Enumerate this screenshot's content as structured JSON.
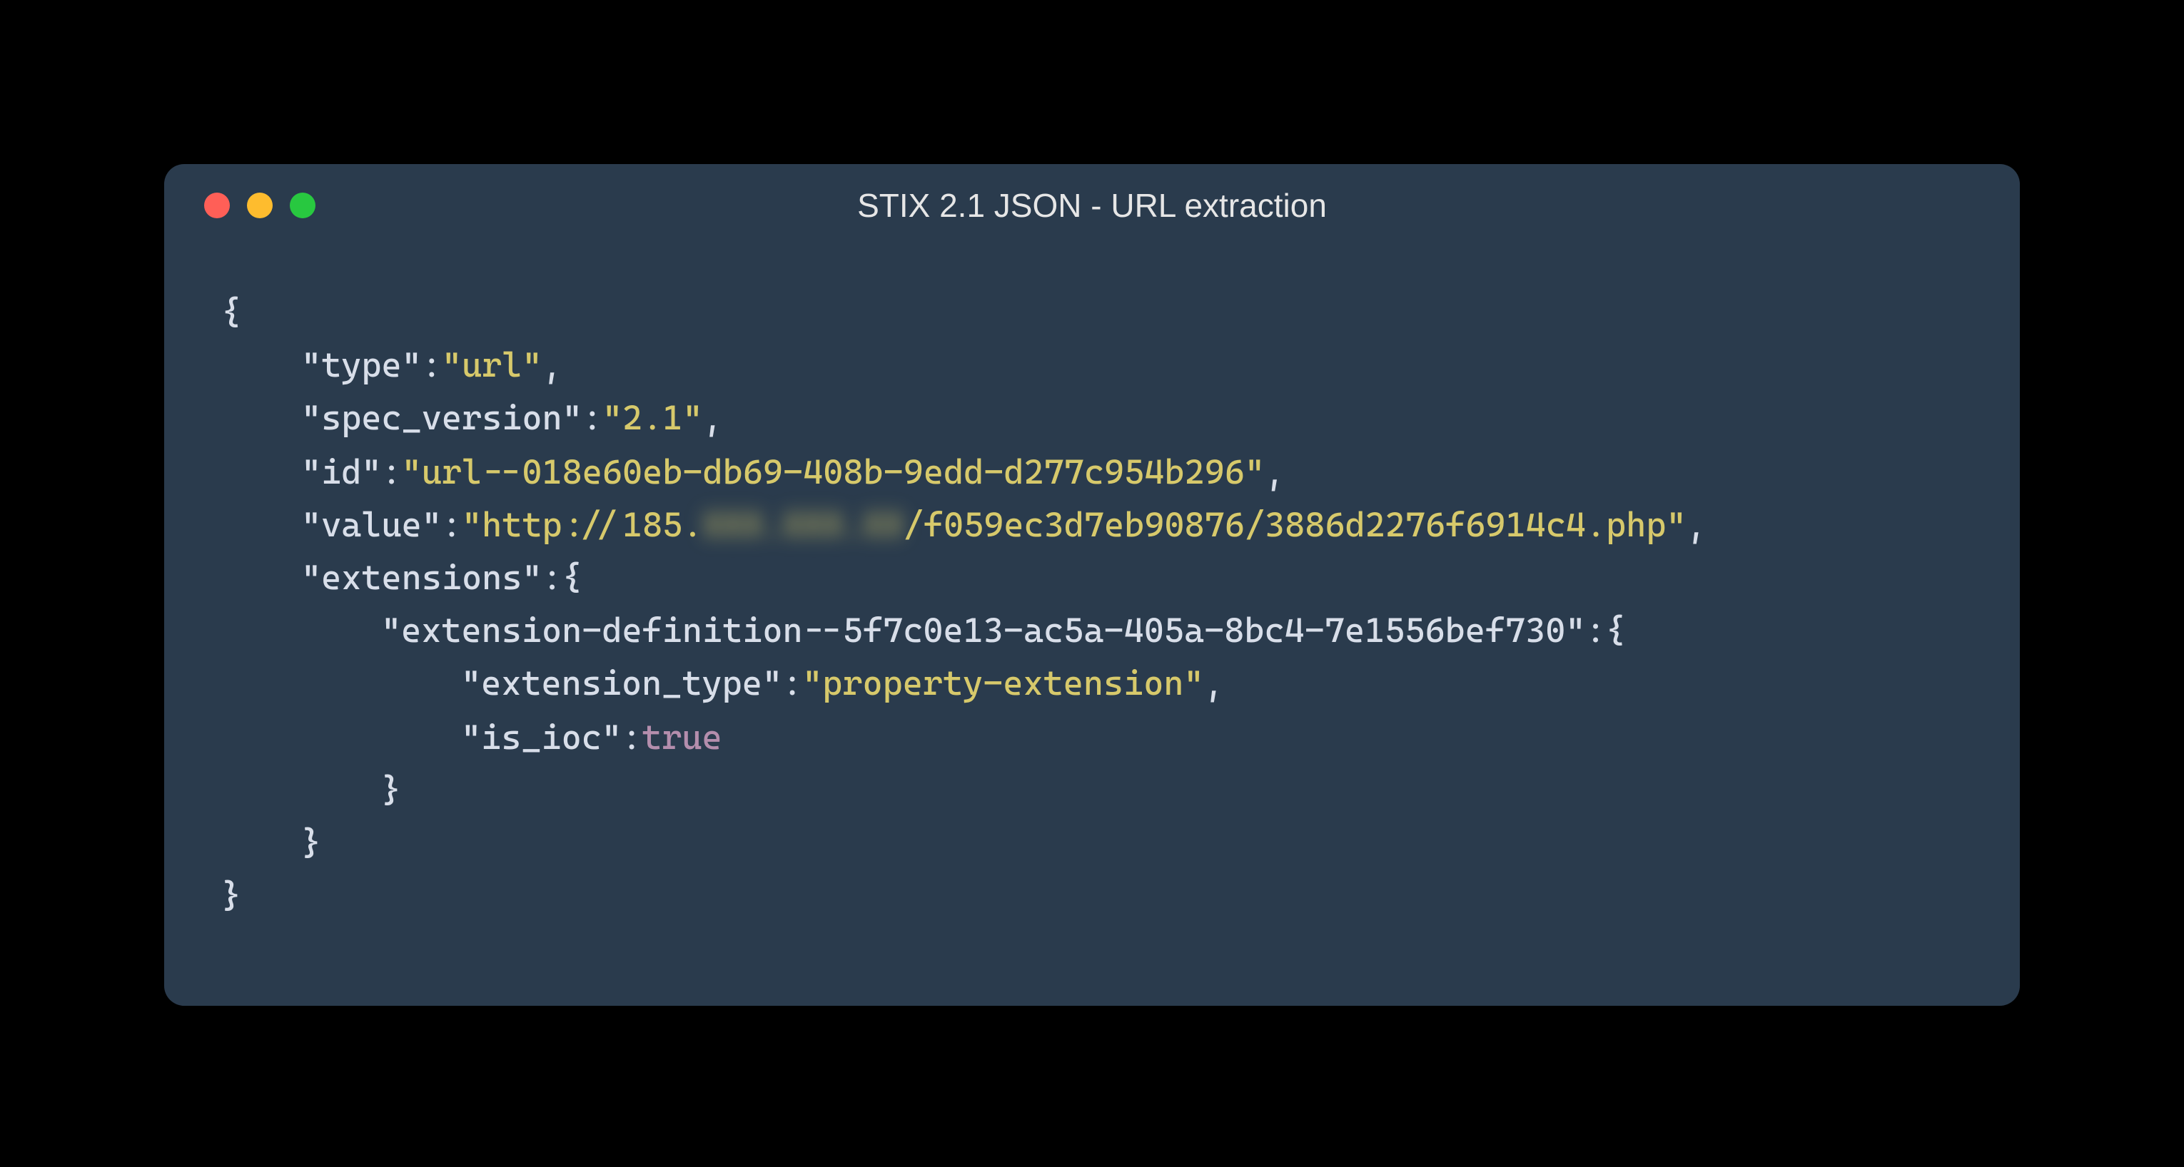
{
  "window": {
    "title": "STIX 2.1 JSON - URL extraction"
  },
  "code": {
    "l1": "{",
    "l2_key": "\"type\"",
    "l2_val": "\"url\"",
    "l3_key": "\"spec_version\"",
    "l3_val": "\"2.1\"",
    "l4_key": "\"id\"",
    "l4_val": "\"url--018e60eb-db69-408b-9edd-d277c954b296\"",
    "l5_key": "\"value\"",
    "l5_val_pre": "\"http://185.",
    "l5_val_redact": "XXX.XXX.XX",
    "l5_val_post": "/f059ec3d7eb90876/3886d2276f6914c4.php\"",
    "l6_key": "\"extensions\"",
    "l7_key": "\"extension-definition--5f7c0e13-ac5a-405a-8bc4-7e1556bef730\"",
    "l8_key": "\"extension_type\"",
    "l8_val": "\"property-extension\"",
    "l9_key": "\"is_ioc\"",
    "l9_val": "true",
    "comma": ",",
    "colon": ":",
    "brace_o": "{",
    "brace_c": "}"
  }
}
